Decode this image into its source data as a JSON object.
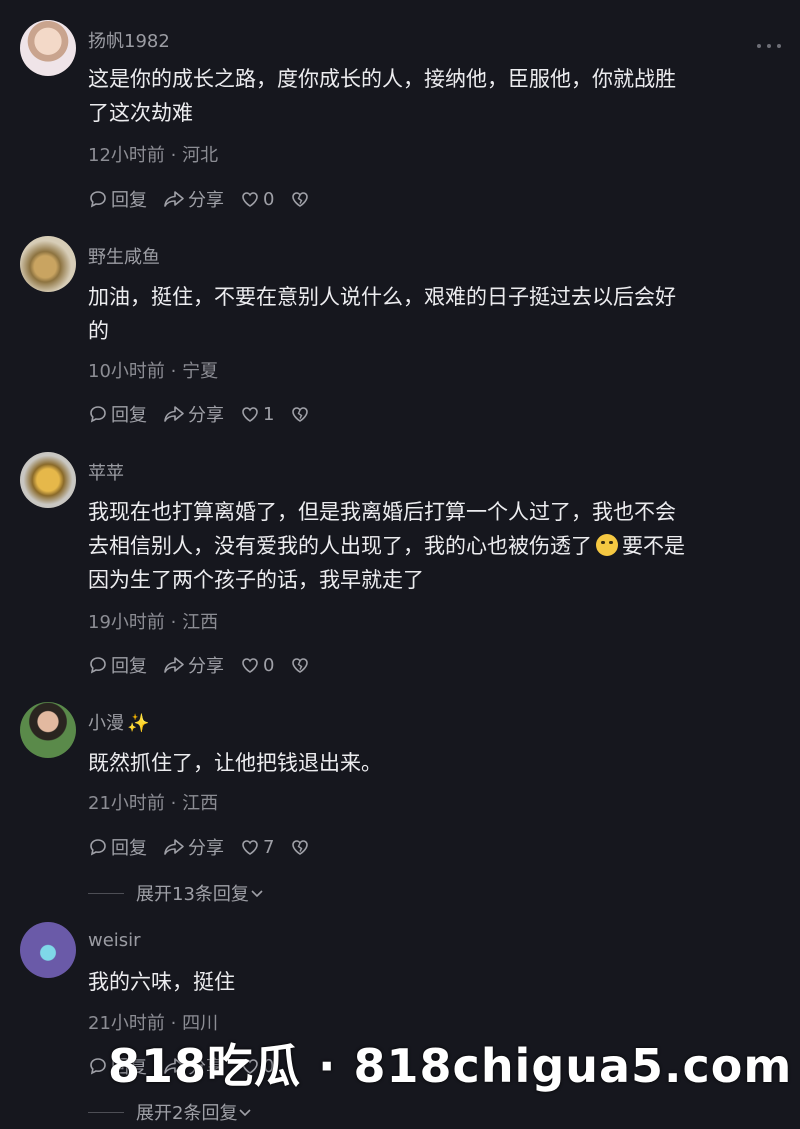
{
  "comments": [
    {
      "username": "扬帆1982",
      "text_lines": [
        "这是你的成长之路，度你成长的人，接纳他，臣服他，你就战胜",
        "了这次劫难"
      ],
      "meta": "12小时前 · 河北",
      "reply_label": "回复",
      "share_label": "分享",
      "like_count": "0"
    },
    {
      "username": "野生咸鱼",
      "text_lines": [
        "加油，挺住，不要在意别人说什么，艰难的日子挺过去以后会好",
        "的"
      ],
      "meta": "10小时前 · 宁夏",
      "reply_label": "回复",
      "share_label": "分享",
      "like_count": "1"
    },
    {
      "username": "苹苹",
      "text_lines": [
        "我现在也打算离婚了，但是我离婚后打算一个人过了，我也不会",
        "去相信别人，没有爱我的人出现了，我的心也被伤透了",
        "要不是",
        "因为生了两个孩子的话，我早就走了"
      ],
      "meta": "19小时前 · 江西",
      "reply_label": "回复",
      "share_label": "分享",
      "like_count": "0"
    },
    {
      "username": "小漫",
      "username_sparkle": "✨",
      "text_lines": [
        "既然抓住了，让他把钱退出来。"
      ],
      "meta": "21小时前 · 江西",
      "reply_label": "回复",
      "share_label": "分享",
      "like_count": "7",
      "expand_label": "展开13条回复"
    },
    {
      "username": "weisir",
      "text_lines": [
        "我的六味，挺住"
      ],
      "meta": "21小时前 · 四川",
      "reply_label": "回复",
      "share_label": "分享",
      "like_count": "0",
      "expand_label": "展开2条回复"
    }
  ],
  "watermark": "818吃瓜 · 818chigua5.com",
  "colors": {
    "background": "#16171e",
    "text": "#ececef",
    "secondary": "#8c8d94"
  }
}
